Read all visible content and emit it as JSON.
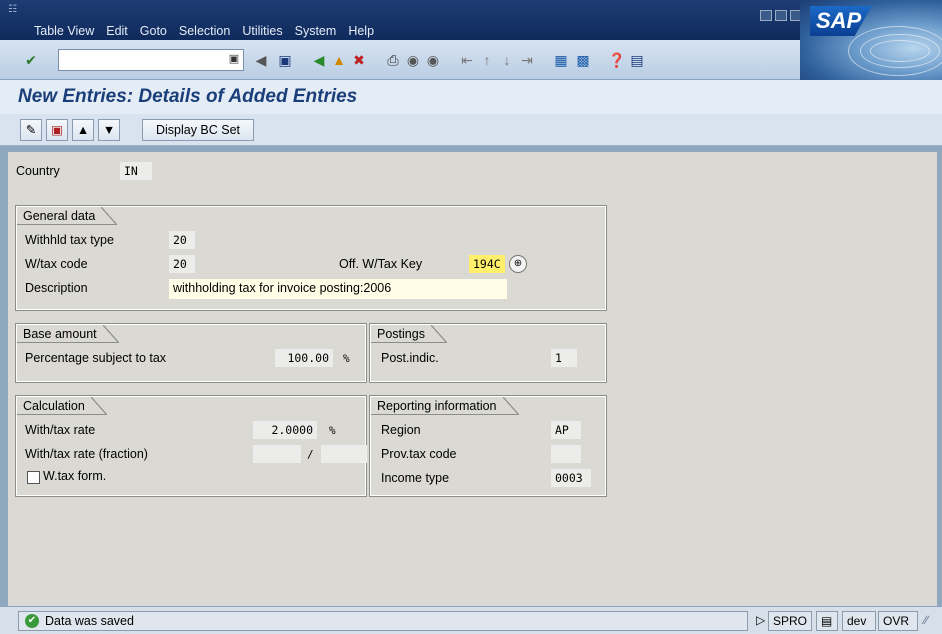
{
  "menu": {
    "items": [
      "Table View",
      "Edit",
      "Goto",
      "Selection",
      "Utilities",
      "System",
      "Help"
    ]
  },
  "brand": {
    "logo_text": "SAP"
  },
  "title": "New Entries: Details of Added Entries",
  "app_toolbar": {
    "display_bc_set": "Display BC Set"
  },
  "country": {
    "label": "Country",
    "value": "IN"
  },
  "general_data": {
    "title": "General data",
    "withhld_tax_type_label": "Withhld tax type",
    "withhld_tax_type_value": "20",
    "wtax_code_label": "W/tax code",
    "wtax_code_value": "20",
    "off_wtax_key_label": "Off. W/Tax Key",
    "off_wtax_key_value": "194C",
    "description_label": "Description",
    "description_value": "withholding tax for invoice posting:2006"
  },
  "base_amount": {
    "title": "Base amount",
    "pct_label": "Percentage subject to tax",
    "pct_value": "100.00",
    "pct_unit": "%"
  },
  "postings": {
    "title": "Postings",
    "post_indic_label": "Post.indic.",
    "post_indic_value": "1"
  },
  "calculation": {
    "title": "Calculation",
    "rate_label": "With/tax rate",
    "rate_value": "2.0000",
    "rate_unit": "%",
    "fraction_label": "With/tax rate (fraction)",
    "fraction_sep": "/",
    "wtax_form_label": "W.tax form."
  },
  "reporting": {
    "title": "Reporting information",
    "region_label": "Region",
    "region_value": "AP",
    "prov_tax_code_label": "Prov.tax code",
    "income_type_label": "Income type",
    "income_type_value": "0003"
  },
  "status": {
    "message": "Data was saved",
    "transaction": "SPRO",
    "client": "dev",
    "mode": "OVR"
  }
}
